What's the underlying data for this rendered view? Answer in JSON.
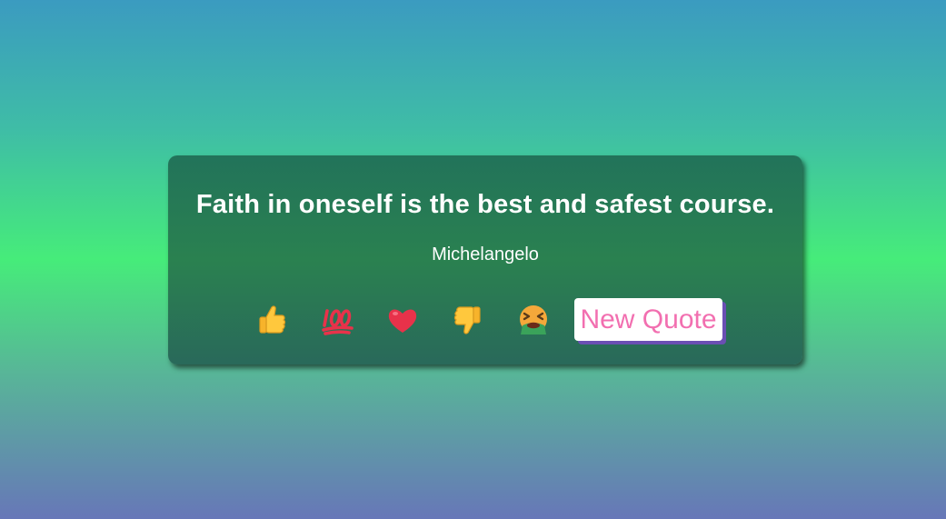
{
  "quote": {
    "text": "Faith in oneself is the best and safest course.",
    "author": "Michelangelo"
  },
  "reactions": [
    {
      "icon": "thumbs-up-icon"
    },
    {
      "icon": "hundred-points-icon"
    },
    {
      "icon": "red-heart-icon"
    },
    {
      "icon": "thumbs-down-icon"
    },
    {
      "icon": "nauseated-face-icon"
    }
  ],
  "buttons": {
    "new_quote_label": "New Quote"
  },
  "colors": {
    "card_bg": "#257a55",
    "button_text": "#f26fb0",
    "button_shadow": "#6a4fb3",
    "emoji_yellow": "#ffc83d",
    "emoji_red": "#e8324a"
  }
}
